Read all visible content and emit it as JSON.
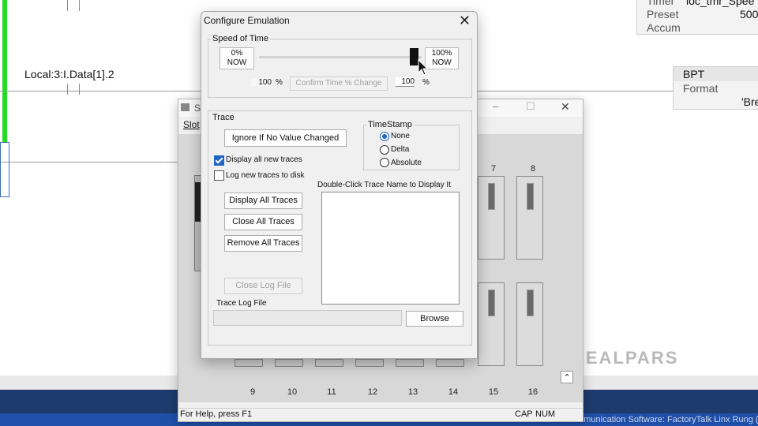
{
  "background": {
    "tag": "Local:3:I.Data[1].2",
    "timer_box": {
      "timer_label": "Timer",
      "timer_value": "loc_tmr_Spee",
      "preset_label": "Preset",
      "preset_value": "500",
      "accum_label": "Accum"
    },
    "bpt_box": {
      "title": "BPT",
      "format_label": "Format",
      "format_value": "'Bre"
    },
    "logo": "REALPARS",
    "status_strip": "Communication Software: FactoryTalk Linx    Rung (End"
  },
  "chassis_window": {
    "title_fragment": "St",
    "menu_fragment": "Slot",
    "slot_numbers_top": [
      "7",
      "8"
    ],
    "slot_numbers_bottom": [
      "9",
      "10",
      "11",
      "12",
      "13",
      "14",
      "15",
      "16"
    ],
    "status_help": "For Help, press F1",
    "status_cap": "CAP",
    "status_num": "NUM",
    "minimize_icon": "–",
    "maximize_icon": "☐",
    "close_icon": "✕",
    "scroll_icon": "⌃"
  },
  "dialog": {
    "title": "Configure Emulation",
    "close_icon": "✕",
    "speed": {
      "group_label": "Speed of Time",
      "left_box": [
        "0%",
        "NOW"
      ],
      "right_box": [
        "100%",
        "NOW"
      ],
      "slider_value": 1.0,
      "field_left_value": "100",
      "field_left_unit": "%",
      "confirm_label": "Confirm Time % Change",
      "field_right_value": "100",
      "field_right_unit": "%"
    },
    "trace": {
      "group_label": "Trace",
      "ignore_button": "Ignore If No Value Changed",
      "display_new_label": "Display all new traces",
      "display_new_checked": true,
      "log_disk_label": "Log new traces to disk",
      "log_disk_checked": false,
      "display_all_button": "Display All Traces",
      "close_all_button": "Close All Traces",
      "remove_all_button": "Remove All Traces",
      "close_log_button": "Close Log File",
      "log_file_label": "Trace Log File",
      "browse_button": "Browse",
      "list_label": "Double-Click Trace Name to Display It",
      "timestamp": {
        "group_label": "TimeStamp",
        "options": [
          "None",
          "Delta",
          "Absolute"
        ],
        "selected": "None"
      }
    }
  }
}
